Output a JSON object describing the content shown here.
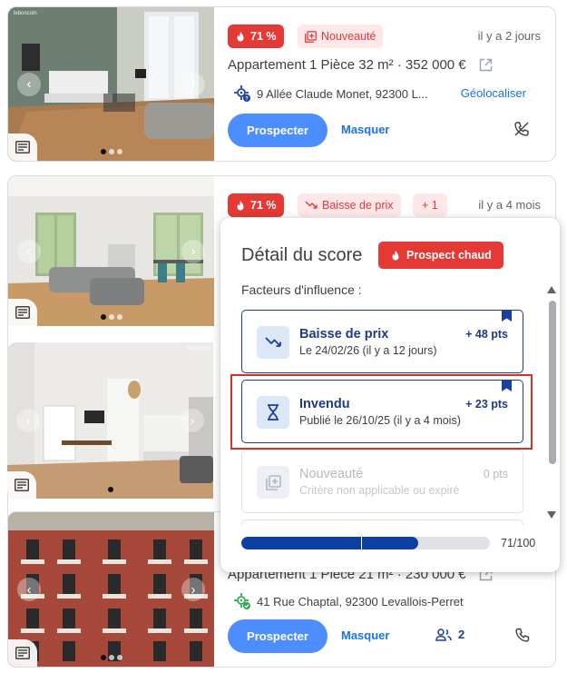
{
  "colors": {
    "hot": "#e53935",
    "accent": "#1a73e8",
    "primary_button": "#4c8dff",
    "navy": "#1e3a8a",
    "highlight": "#d93025"
  },
  "listings": [
    {
      "score_badge": "71 %",
      "tag": "Nouveauté",
      "time": "il y a 2 jours",
      "title": "Appartement 1 Pièce 32 m² · 352 000 €",
      "address": "9 Allée Claude Monet, 92300 L...",
      "geolocate_label": "Géolocaliser",
      "prospect_label": "Prospecter",
      "hide_label": "Masquer",
      "watermark": "leboncoin"
    },
    {
      "score_badge": "71 %",
      "tag": "Baisse de prix",
      "extra_tag": "+ 1",
      "time": "il y a 4 mois"
    },
    {
      "watermark": "leboncoin"
    },
    {
      "title": "Appartement 1 Pièce 21 m² · 230 000 €",
      "address": "41 Rue Chaptal, 92300 Levallois-Perret",
      "prospect_label": "Prospecter",
      "hide_label": "Masquer",
      "contacts_count": "2"
    }
  ],
  "score_detail": {
    "title": "Détail du score",
    "hot_label": "Prospect chaud",
    "subtitle": "Facteurs d'influence :",
    "factors": [
      {
        "name": "Baisse de prix",
        "desc": "Le 24/02/26 (il y a 12 jours)",
        "points": "+ 48 pts",
        "icon": "trending-down-icon",
        "active": true
      },
      {
        "name": "Invendu",
        "desc": "Publié le 26/10/25 (il y a 4 mois)",
        "points": "+ 23 pts",
        "icon": "hourglass-icon",
        "active": true
      },
      {
        "name": "Nouveauté",
        "desc": "Critère non applicable ou expiré",
        "points": "0 pts",
        "icon": "new-badge-icon",
        "active": false
      }
    ],
    "score_value": 71,
    "score_max": 100,
    "score_text": "71/100",
    "score_segments": [
      48,
      23
    ]
  }
}
